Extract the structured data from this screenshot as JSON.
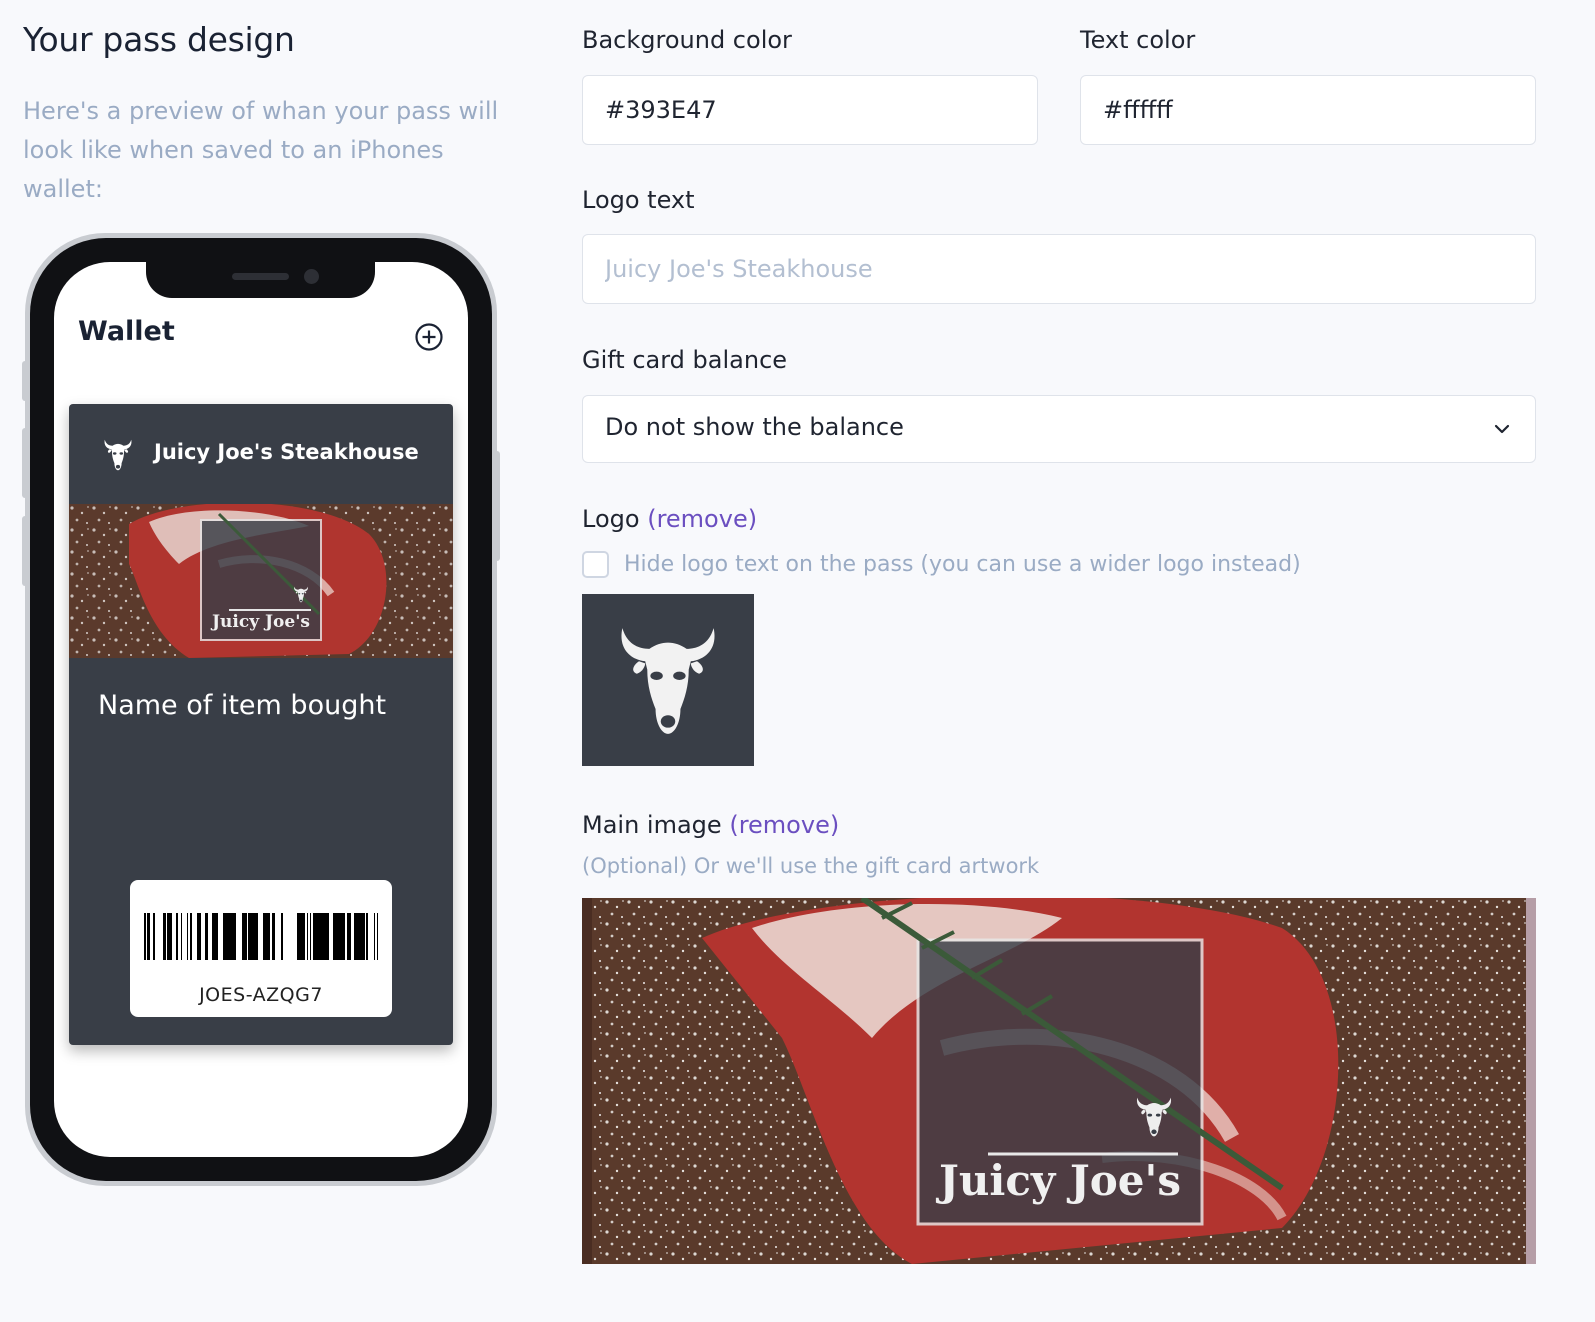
{
  "left": {
    "title": "Your pass design",
    "intro": "Here's a preview of whan your pass will look like when saved to an iPhones wallet:"
  },
  "phone": {
    "wallet_title": "Wallet",
    "add_icon": "plus-circle-icon",
    "pass": {
      "logo_icon": "bull-head-icon",
      "logo_text": "Juicy Joe's Steakhouse",
      "strip_image_text": "Juicy Joe's",
      "item_name": "Name of item bought",
      "barcode_text": "JOES-AZQG7",
      "background_color": "#393E47",
      "text_color": "#ffffff"
    }
  },
  "form": {
    "background_color": {
      "label": "Background color",
      "value": "#393E47"
    },
    "text_color": {
      "label": "Text color",
      "value": "#ffffff"
    },
    "logo_text": {
      "label": "Logo text",
      "placeholder": "Juicy Joe's Steakhouse",
      "value": ""
    },
    "gift_card_balance": {
      "label": "Gift card balance",
      "selected": "Do not show the balance"
    },
    "logo": {
      "label": "Logo",
      "remove": "(remove)",
      "hide_logo_text_label": "Hide logo text on the pass (you can use a wider logo instead)",
      "hide_logo_text_checked": false
    },
    "main_image": {
      "label": "Main image",
      "remove": "(remove)",
      "helper": "(Optional) Or we'll use the gift card artwork",
      "image_text": "Juicy Joe's"
    }
  },
  "colors": {
    "link": "#6b4fc0",
    "muted_text": "#9aabc4"
  }
}
